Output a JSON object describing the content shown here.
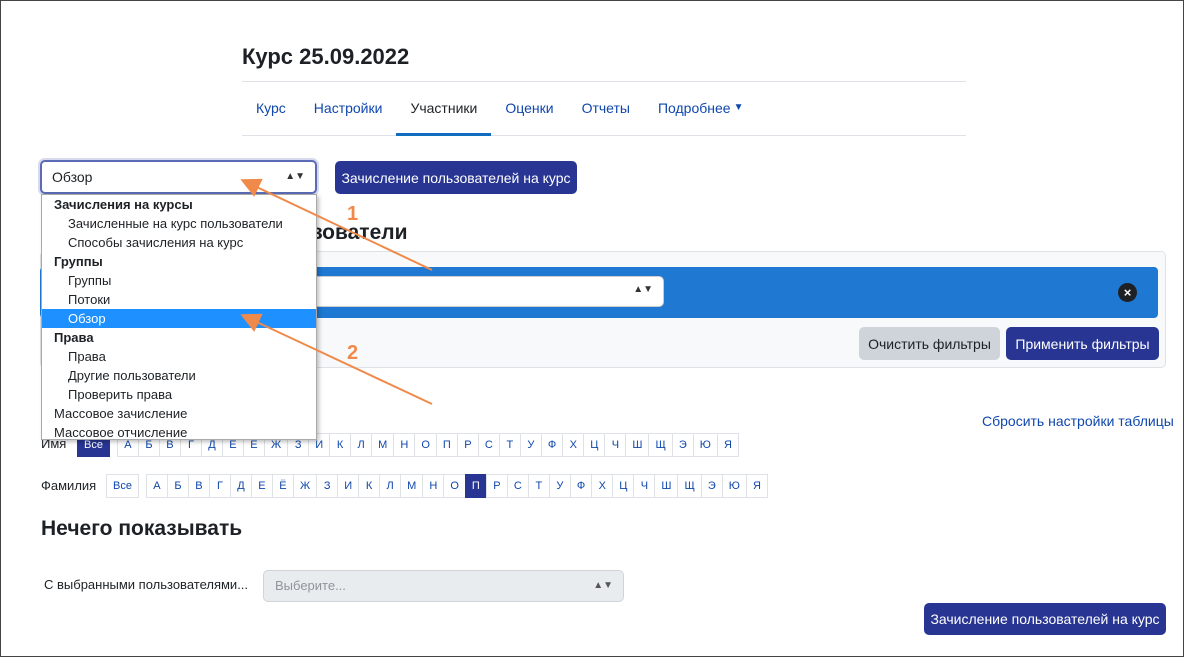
{
  "course": {
    "title": "Курс 25.09.2022"
  },
  "nav": {
    "items": [
      {
        "label": "Курс",
        "active": false
      },
      {
        "label": "Настройки",
        "active": false
      },
      {
        "label": "Участники",
        "active": true
      },
      {
        "label": "Оценки",
        "active": false
      },
      {
        "label": "Отчеты",
        "active": false
      },
      {
        "label": "Подробнее",
        "active": false,
        "dropdown": true
      }
    ],
    "more_chevron": "chevron-down-icon"
  },
  "participants_select": {
    "value": "Обзор",
    "options": [
      {
        "label": "Зачисления на курсы",
        "type": "group"
      },
      {
        "label": "Зачисленные на курс пользователи",
        "type": "option"
      },
      {
        "label": "Способы зачисления на курс",
        "type": "option"
      },
      {
        "label": "Группы",
        "type": "group"
      },
      {
        "label": "Группы",
        "type": "option"
      },
      {
        "label": "Потоки",
        "type": "option"
      },
      {
        "label": "Обзор",
        "type": "option",
        "selected": true
      },
      {
        "label": "Права",
        "type": "group"
      },
      {
        "label": "Права",
        "type": "option"
      },
      {
        "label": "Другие пользователи",
        "type": "option"
      },
      {
        "label": "Проверить права",
        "type": "option"
      },
      {
        "label": "Массовое зачисление",
        "type": "top"
      },
      {
        "label": "Массовое отчисление",
        "type": "top"
      }
    ]
  },
  "enrol_button": {
    "label": "Зачисление пользователей на курс"
  },
  "section_heading": "льзователи",
  "filters": {
    "clear_label": "Очистить фильтры",
    "apply_label": "Применить фильтры",
    "remove_icon": "close-circle-icon"
  },
  "reset_table": "Сбросить настройки таблицы",
  "initials": {
    "firstname_label": "Имя",
    "lastname_label": "Фамилия",
    "all_label": "Все",
    "letters": [
      "А",
      "Б",
      "В",
      "Г",
      "Д",
      "Е",
      "Ё",
      "Ж",
      "З",
      "И",
      "К",
      "Л",
      "М",
      "Н",
      "О",
      "П",
      "Р",
      "С",
      "Т",
      "У",
      "Ф",
      "Х",
      "Ц",
      "Ч",
      "Ш",
      "Щ",
      "Э",
      "Ю",
      "Я"
    ],
    "lastname_selected": "П"
  },
  "nothing_to_display": "Нечего показывать",
  "bulk": {
    "label": "С выбранными пользователями...",
    "placeholder": "Выберите..."
  },
  "annotations": {
    "label_1": "1",
    "label_2": "2",
    "color": "#f08a4b"
  },
  "colors": {
    "primary": "#283593",
    "link": "#0f47ad",
    "filter_row": "#1f78d1",
    "highlight": "#1e90ff"
  }
}
